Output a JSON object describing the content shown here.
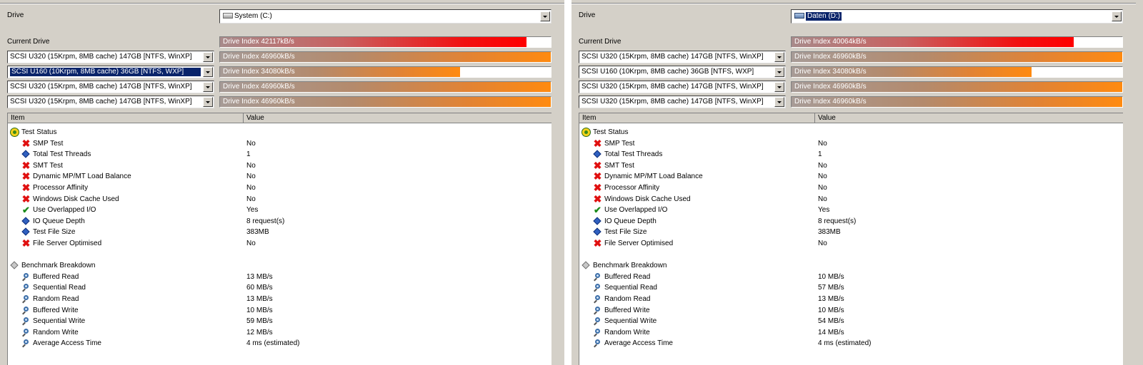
{
  "panels": [
    {
      "drive_label": "Drive",
      "drive_value": "System (C:)",
      "drive_selected": false,
      "current_drive_label": "Current Drive",
      "bars": [
        {
          "text": "Drive Index 42117kB/s",
          "fill": 0.927,
          "color": "red"
        },
        {
          "text": "Drive Index 46960kB/s",
          "fill": 1.0,
          "color": "orange"
        },
        {
          "text": "Drive Index 34080kB/s",
          "fill": 0.726,
          "color": "orange"
        },
        {
          "text": "Drive Index 46960kB/s",
          "fill": 1.0,
          "color": "orange"
        },
        {
          "text": "Drive Index 46960kB/s",
          "fill": 1.0,
          "color": "orange"
        }
      ],
      "drives": [
        {
          "value": "SCSI U320 (15Krpm, 8MB cache) 147GB [NTFS, WinXP]",
          "selected": false
        },
        {
          "value": "SCSI U160 (10Krpm, 8MB cache) 36GB [NTFS, WXP]",
          "selected": true
        },
        {
          "value": "SCSI U320 (15Krpm, 8MB cache) 147GB [NTFS, WinXP]",
          "selected": false
        },
        {
          "value": "SCSI U320 (15Krpm, 8MB cache) 147GB [NTFS, WinXP]",
          "selected": false
        }
      ],
      "columns": {
        "item": "Item",
        "value": "Value"
      },
      "rows": [
        {
          "icon": "group-green-icon",
          "label": "Test Status",
          "value": "",
          "indent": 0
        },
        {
          "icon": "red-x-icon",
          "label": "SMP Test",
          "value": "No",
          "indent": 1
        },
        {
          "icon": "blue-diamond-icon",
          "label": "Total Test Threads",
          "value": "1",
          "indent": 1
        },
        {
          "icon": "red-x-icon",
          "label": "SMT Test",
          "value": "No",
          "indent": 1
        },
        {
          "icon": "red-x-icon",
          "label": "Dynamic MP/MT Load Balance",
          "value": "No",
          "indent": 1
        },
        {
          "icon": "red-x-icon",
          "label": "Processor Affinity",
          "value": "No",
          "indent": 1
        },
        {
          "icon": "red-x-icon",
          "label": "Windows Disk Cache Used",
          "value": "No",
          "indent": 1
        },
        {
          "icon": "green-check-icon",
          "label": "Use Overlapped I/O",
          "value": "Yes",
          "indent": 1
        },
        {
          "icon": "blue-diamond-icon",
          "label": "IO Queue Depth",
          "value": "8 request(s)",
          "indent": 1
        },
        {
          "icon": "blue-diamond-icon",
          "label": "Test File Size",
          "value": "383MB",
          "indent": 1
        },
        {
          "icon": "red-x-icon",
          "label": "File Server Optimised",
          "value": "No",
          "indent": 1
        },
        {
          "icon": "",
          "label": "",
          "value": "",
          "indent": 0
        },
        {
          "icon": "gray-diamond-icon",
          "label": "Benchmark Breakdown",
          "value": "",
          "indent": 0
        },
        {
          "icon": "magnifier-icon",
          "label": "Buffered Read",
          "value": "13 MB/s",
          "indent": 1
        },
        {
          "icon": "magnifier-icon",
          "label": "Sequential Read",
          "value": "60 MB/s",
          "indent": 1
        },
        {
          "icon": "magnifier-icon",
          "label": "Random Read",
          "value": "13 MB/s",
          "indent": 1
        },
        {
          "icon": "magnifier-icon",
          "label": "Buffered Write",
          "value": "10 MB/s",
          "indent": 1
        },
        {
          "icon": "magnifier-icon",
          "label": "Sequential Write",
          "value": "59 MB/s",
          "indent": 1
        },
        {
          "icon": "magnifier-icon",
          "label": "Random Write",
          "value": "12 MB/s",
          "indent": 1
        },
        {
          "icon": "magnifier-icon",
          "label": "Average Access Time",
          "value": "4 ms (estimated)",
          "indent": 1
        }
      ]
    },
    {
      "drive_label": "Drive",
      "drive_value": "Daten (D:)",
      "drive_selected": true,
      "current_drive_label": "Current Drive",
      "bars": [
        {
          "text": "Drive Index 40064kB/s",
          "fill": 0.853,
          "color": "red"
        },
        {
          "text": "Drive Index 46960kB/s",
          "fill": 1.0,
          "color": "orange"
        },
        {
          "text": "Drive Index 34080kB/s",
          "fill": 0.726,
          "color": "orange"
        },
        {
          "text": "Drive Index 46960kB/s",
          "fill": 1.0,
          "color": "orange"
        },
        {
          "text": "Drive Index 46960kB/s",
          "fill": 1.0,
          "color": "orange"
        }
      ],
      "drives": [
        {
          "value": "SCSI U320 (15Krpm, 8MB cache) 147GB [NTFS, WinXP]",
          "selected": false
        },
        {
          "value": "SCSI U160 (10Krpm, 8MB cache) 36GB [NTFS, WXP]",
          "selected": false
        },
        {
          "value": "SCSI U320 (15Krpm, 8MB cache) 147GB [NTFS, WinXP]",
          "selected": false
        },
        {
          "value": "SCSI U320 (15Krpm, 8MB cache) 147GB [NTFS, WinXP]",
          "selected": false
        }
      ],
      "columns": {
        "item": "Item",
        "value": "Value"
      },
      "rows": [
        {
          "icon": "group-green-icon",
          "label": "Test Status",
          "value": "",
          "indent": 0
        },
        {
          "icon": "red-x-icon",
          "label": "SMP Test",
          "value": "No",
          "indent": 1
        },
        {
          "icon": "blue-diamond-icon",
          "label": "Total Test Threads",
          "value": "1",
          "indent": 1
        },
        {
          "icon": "red-x-icon",
          "label": "SMT Test",
          "value": "No",
          "indent": 1
        },
        {
          "icon": "red-x-icon",
          "label": "Dynamic MP/MT Load Balance",
          "value": "No",
          "indent": 1
        },
        {
          "icon": "red-x-icon",
          "label": "Processor Affinity",
          "value": "No",
          "indent": 1
        },
        {
          "icon": "red-x-icon",
          "label": "Windows Disk Cache Used",
          "value": "No",
          "indent": 1
        },
        {
          "icon": "green-check-icon",
          "label": "Use Overlapped I/O",
          "value": "Yes",
          "indent": 1
        },
        {
          "icon": "blue-diamond-icon",
          "label": "IO Queue Depth",
          "value": "8 request(s)",
          "indent": 1
        },
        {
          "icon": "blue-diamond-icon",
          "label": "Test File Size",
          "value": "383MB",
          "indent": 1
        },
        {
          "icon": "red-x-icon",
          "label": "File Server Optimised",
          "value": "No",
          "indent": 1
        },
        {
          "icon": "",
          "label": "",
          "value": "",
          "indent": 0
        },
        {
          "icon": "gray-diamond-icon",
          "label": "Benchmark Breakdown",
          "value": "",
          "indent": 0
        },
        {
          "icon": "magnifier-icon",
          "label": "Buffered Read",
          "value": "10 MB/s",
          "indent": 1
        },
        {
          "icon": "magnifier-icon",
          "label": "Sequential Read",
          "value": "57 MB/s",
          "indent": 1
        },
        {
          "icon": "magnifier-icon",
          "label": "Random Read",
          "value": "13 MB/s",
          "indent": 1
        },
        {
          "icon": "magnifier-icon",
          "label": "Buffered Write",
          "value": "10 MB/s",
          "indent": 1
        },
        {
          "icon": "magnifier-icon",
          "label": "Sequential Write",
          "value": "54 MB/s",
          "indent": 1
        },
        {
          "icon": "magnifier-icon",
          "label": "Random Write",
          "value": "14 MB/s",
          "indent": 1
        },
        {
          "icon": "magnifier-icon",
          "label": "Average Access Time",
          "value": "4 ms (estimated)",
          "indent": 1
        }
      ]
    }
  ],
  "colors": {
    "bar_red": "#ff0000",
    "bar_orange": "#ff8a10",
    "selection": "#0a246a"
  }
}
